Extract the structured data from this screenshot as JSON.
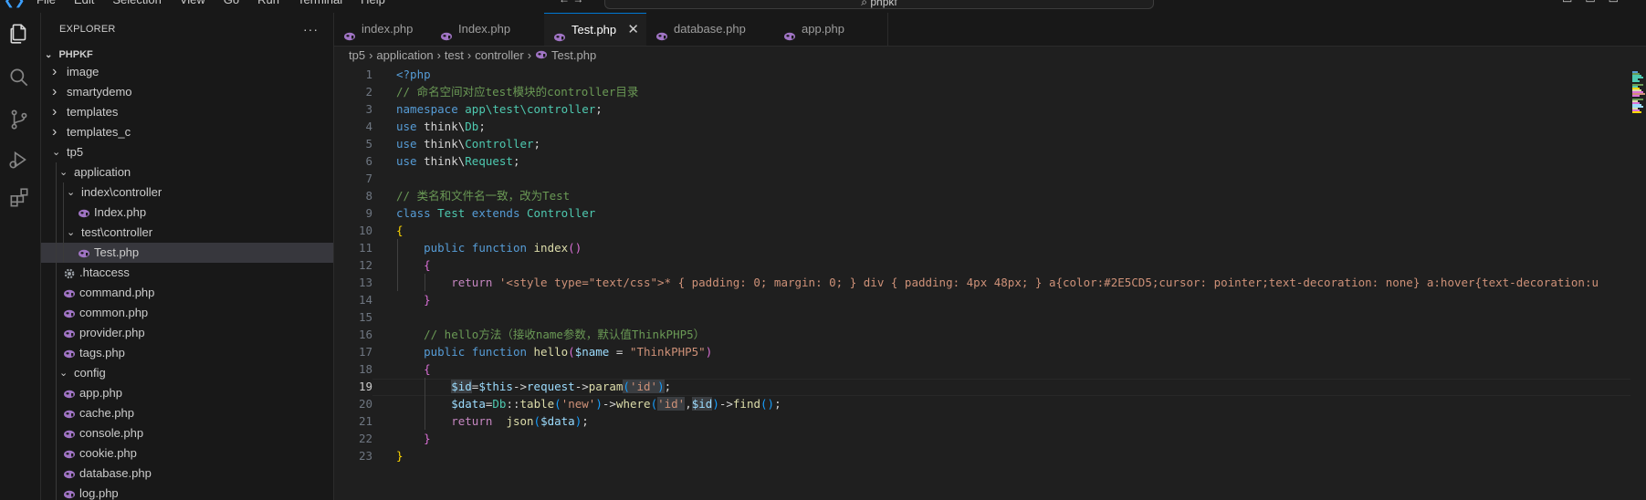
{
  "menubar": {
    "items": [
      "File",
      "Edit",
      "Selection",
      "View",
      "Go",
      "Run",
      "Terminal",
      "Help"
    ],
    "search": "phpkf"
  },
  "sidebar": {
    "title": "EXPLORER",
    "more": "···",
    "project": "PHPKF",
    "rows": [
      {
        "label": "image",
        "kind": "folder",
        "expanded": false
      },
      {
        "label": "smartydemo",
        "kind": "folder",
        "expanded": false
      },
      {
        "label": "templates",
        "kind": "folder",
        "expanded": false
      },
      {
        "label": "templates_c",
        "kind": "folder",
        "expanded": false
      },
      {
        "label": "tp5",
        "kind": "folder",
        "expanded": true
      },
      {
        "label": "application",
        "kind": "folder",
        "expanded": true
      },
      {
        "label": "index\\controller",
        "kind": "folder",
        "expanded": true
      },
      {
        "label": "Index.php",
        "kind": "php"
      },
      {
        "label": "test\\controller",
        "kind": "folder",
        "expanded": true
      },
      {
        "label": "Test.php",
        "kind": "php",
        "selected": true
      },
      {
        "label": ".htaccess",
        "kind": "gear"
      },
      {
        "label": "command.php",
        "kind": "php"
      },
      {
        "label": "common.php",
        "kind": "php"
      },
      {
        "label": "provider.php",
        "kind": "php"
      },
      {
        "label": "tags.php",
        "kind": "php"
      },
      {
        "label": "config",
        "kind": "folder",
        "expanded": true
      },
      {
        "label": "app.php",
        "kind": "php"
      },
      {
        "label": "cache.php",
        "kind": "php"
      },
      {
        "label": "console.php",
        "kind": "php"
      },
      {
        "label": "cookie.php",
        "kind": "php"
      },
      {
        "label": "database.php",
        "kind": "php"
      },
      {
        "label": "log.php",
        "kind": "php"
      }
    ]
  },
  "tabs": [
    {
      "label": "index.php",
      "active": false
    },
    {
      "label": "Index.php",
      "active": false
    },
    {
      "label": "Test.php",
      "active": true
    },
    {
      "label": "database.php",
      "active": false
    },
    {
      "label": "app.php",
      "active": false
    }
  ],
  "close_glyph": "✕",
  "breadcrumb": [
    "tp5",
    "application",
    "test",
    "controller",
    "Test.php"
  ],
  "editor": {
    "current_line": 19,
    "lines": [
      [
        [
          "t-tag",
          "<?php"
        ]
      ],
      [
        [
          "t-cm",
          "// 命名空间对应test模块的controller目录"
        ]
      ],
      [
        [
          "t-kw",
          "namespace "
        ],
        [
          "t-ns",
          "app\\test\\controller"
        ],
        [
          "t-pl",
          ";"
        ]
      ],
      [
        [
          "t-kw",
          "use "
        ],
        [
          "t-pl",
          "think\\"
        ],
        [
          "t-ns",
          "Db"
        ],
        [
          "t-pl",
          ";"
        ]
      ],
      [
        [
          "t-kw",
          "use "
        ],
        [
          "t-pl",
          "think\\"
        ],
        [
          "t-ns",
          "Controller"
        ],
        [
          "t-pl",
          ";"
        ]
      ],
      [
        [
          "t-kw",
          "use "
        ],
        [
          "t-pl",
          "think\\"
        ],
        [
          "t-ns",
          "Request"
        ],
        [
          "t-pl",
          ";"
        ]
      ],
      [],
      [
        [
          "t-cm",
          "// 类名和文件名一致，改为Test"
        ]
      ],
      [
        [
          "t-kw",
          "class "
        ],
        [
          "t-ns",
          "Test "
        ],
        [
          "t-kw",
          "extends "
        ],
        [
          "t-ns",
          "Controller"
        ]
      ],
      [
        [
          "t-br1",
          "{"
        ]
      ],
      [
        [
          "t-pl",
          "    "
        ],
        [
          "t-kw",
          "public function "
        ],
        [
          "t-fn",
          "index"
        ],
        [
          "t-br2",
          "()"
        ]
      ],
      [
        [
          "t-pl",
          "    "
        ],
        [
          "t-br2",
          "{"
        ]
      ],
      [
        [
          "t-pl",
          "        "
        ],
        [
          "t-ctl",
          "return "
        ],
        [
          "t-str",
          "'<style type=\"text/css\">* { padding: 0; margin: 0; } div { padding: 4px 48px; } a{color:#2E5CD5;cursor: pointer;text-decoration: none} a:hover{text-decoration:u"
        ]
      ],
      [
        [
          "t-pl",
          "    "
        ],
        [
          "t-br2",
          "}"
        ]
      ],
      [],
      [
        [
          "t-pl",
          "    "
        ],
        [
          "t-cm",
          "// hello方法（接收name参数，默认值ThinkPHP5）"
        ]
      ],
      [
        [
          "t-pl",
          "    "
        ],
        [
          "t-kw",
          "public function "
        ],
        [
          "t-fn",
          "hello"
        ],
        [
          "t-br2",
          "("
        ],
        [
          "t-var",
          "$name"
        ],
        [
          "t-pl",
          " = "
        ],
        [
          "t-str",
          "\"ThinkPHP5\""
        ],
        [
          "t-br2",
          ")"
        ]
      ],
      [
        [
          "t-pl",
          "    "
        ],
        [
          "t-br2",
          "{"
        ]
      ],
      [
        [
          "t-pl",
          "        "
        ],
        [
          "t-var hl",
          "$id"
        ],
        [
          "t-pl",
          "="
        ],
        [
          "t-var",
          "$this"
        ],
        [
          "t-pl",
          "->"
        ],
        [
          "t-var",
          "request"
        ],
        [
          "t-pl",
          "->"
        ],
        [
          "t-fn",
          "param"
        ],
        [
          "t-br3 hl",
          "("
        ],
        [
          "t-str hl",
          "'id'"
        ],
        [
          "t-br3 hl",
          ")"
        ],
        [
          "t-pl",
          ";"
        ]
      ],
      [
        [
          "t-pl",
          "        "
        ],
        [
          "t-var",
          "$data"
        ],
        [
          "t-pl",
          "="
        ],
        [
          "t-ns",
          "Db"
        ],
        [
          "t-pl",
          "::"
        ],
        [
          "t-fn",
          "table"
        ],
        [
          "t-br3",
          "("
        ],
        [
          "t-str",
          "'new'"
        ],
        [
          "t-br3",
          ")"
        ],
        [
          "t-pl",
          "->"
        ],
        [
          "t-fn",
          "where"
        ],
        [
          "t-br3",
          "("
        ],
        [
          "t-str hl",
          "'id'"
        ],
        [
          "t-pl",
          ","
        ],
        [
          "t-var hl",
          "$id"
        ],
        [
          "t-br3",
          ")"
        ],
        [
          "t-pl",
          "->"
        ],
        [
          "t-fn",
          "find"
        ],
        [
          "t-br3",
          "()"
        ],
        [
          "t-pl",
          ";"
        ]
      ],
      [
        [
          "t-pl",
          "        "
        ],
        [
          "t-ctl",
          "return  "
        ],
        [
          "t-fn",
          "json"
        ],
        [
          "t-br3",
          "("
        ],
        [
          "t-var",
          "$data"
        ],
        [
          "t-br3",
          ")"
        ],
        [
          "t-pl",
          ";"
        ]
      ],
      [
        [
          "t-pl",
          "    "
        ],
        [
          "t-br2",
          "}"
        ]
      ],
      [
        [
          "t-br1",
          "}"
        ]
      ]
    ]
  },
  "colors": {
    "accent": "#0078d4",
    "php_icon": "#a074c4"
  }
}
